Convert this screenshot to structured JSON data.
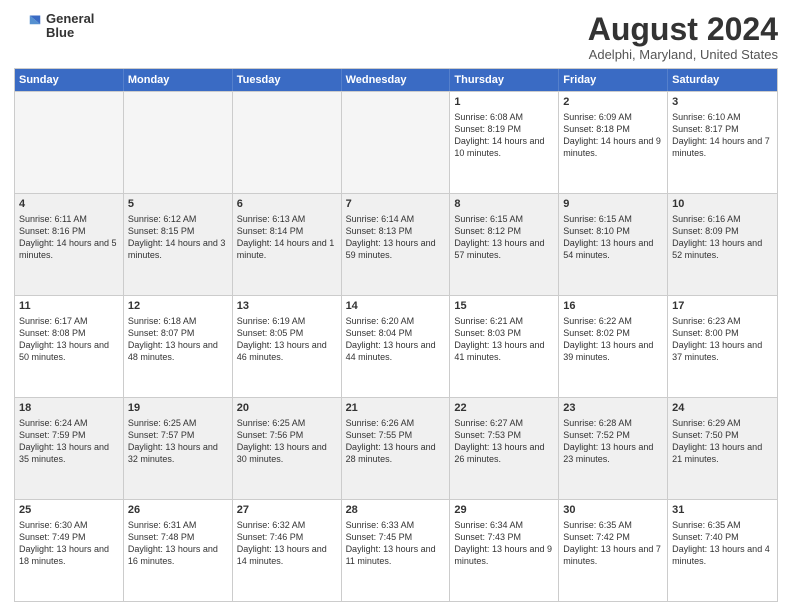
{
  "logo": {
    "line1": "General",
    "line2": "Blue"
  },
  "title": "August 2024",
  "subtitle": "Adelphi, Maryland, United States",
  "header": {
    "days": [
      "Sunday",
      "Monday",
      "Tuesday",
      "Wednesday",
      "Thursday",
      "Friday",
      "Saturday"
    ]
  },
  "rows": [
    {
      "cells": [
        {
          "day": "",
          "info": "",
          "empty": true
        },
        {
          "day": "",
          "info": "",
          "empty": true
        },
        {
          "day": "",
          "info": "",
          "empty": true
        },
        {
          "day": "",
          "info": "",
          "empty": true
        },
        {
          "day": "1",
          "info": "Sunrise: 6:08 AM\nSunset: 8:19 PM\nDaylight: 14 hours and 10 minutes."
        },
        {
          "day": "2",
          "info": "Sunrise: 6:09 AM\nSunset: 8:18 PM\nDaylight: 14 hours and 9 minutes."
        },
        {
          "day": "3",
          "info": "Sunrise: 6:10 AM\nSunset: 8:17 PM\nDaylight: 14 hours and 7 minutes."
        }
      ]
    },
    {
      "cells": [
        {
          "day": "4",
          "info": "Sunrise: 6:11 AM\nSunset: 8:16 PM\nDaylight: 14 hours and 5 minutes.",
          "shaded": true
        },
        {
          "day": "5",
          "info": "Sunrise: 6:12 AM\nSunset: 8:15 PM\nDaylight: 14 hours and 3 minutes.",
          "shaded": true
        },
        {
          "day": "6",
          "info": "Sunrise: 6:13 AM\nSunset: 8:14 PM\nDaylight: 14 hours and 1 minute.",
          "shaded": true
        },
        {
          "day": "7",
          "info": "Sunrise: 6:14 AM\nSunset: 8:13 PM\nDaylight: 13 hours and 59 minutes.",
          "shaded": true
        },
        {
          "day": "8",
          "info": "Sunrise: 6:15 AM\nSunset: 8:12 PM\nDaylight: 13 hours and 57 minutes.",
          "shaded": true
        },
        {
          "day": "9",
          "info": "Sunrise: 6:15 AM\nSunset: 8:10 PM\nDaylight: 13 hours and 54 minutes.",
          "shaded": true
        },
        {
          "day": "10",
          "info": "Sunrise: 6:16 AM\nSunset: 8:09 PM\nDaylight: 13 hours and 52 minutes.",
          "shaded": true
        }
      ]
    },
    {
      "cells": [
        {
          "day": "11",
          "info": "Sunrise: 6:17 AM\nSunset: 8:08 PM\nDaylight: 13 hours and 50 minutes."
        },
        {
          "day": "12",
          "info": "Sunrise: 6:18 AM\nSunset: 8:07 PM\nDaylight: 13 hours and 48 minutes."
        },
        {
          "day": "13",
          "info": "Sunrise: 6:19 AM\nSunset: 8:05 PM\nDaylight: 13 hours and 46 minutes."
        },
        {
          "day": "14",
          "info": "Sunrise: 6:20 AM\nSunset: 8:04 PM\nDaylight: 13 hours and 44 minutes."
        },
        {
          "day": "15",
          "info": "Sunrise: 6:21 AM\nSunset: 8:03 PM\nDaylight: 13 hours and 41 minutes."
        },
        {
          "day": "16",
          "info": "Sunrise: 6:22 AM\nSunset: 8:02 PM\nDaylight: 13 hours and 39 minutes."
        },
        {
          "day": "17",
          "info": "Sunrise: 6:23 AM\nSunset: 8:00 PM\nDaylight: 13 hours and 37 minutes."
        }
      ]
    },
    {
      "cells": [
        {
          "day": "18",
          "info": "Sunrise: 6:24 AM\nSunset: 7:59 PM\nDaylight: 13 hours and 35 minutes.",
          "shaded": true
        },
        {
          "day": "19",
          "info": "Sunrise: 6:25 AM\nSunset: 7:57 PM\nDaylight: 13 hours and 32 minutes.",
          "shaded": true
        },
        {
          "day": "20",
          "info": "Sunrise: 6:25 AM\nSunset: 7:56 PM\nDaylight: 13 hours and 30 minutes.",
          "shaded": true
        },
        {
          "day": "21",
          "info": "Sunrise: 6:26 AM\nSunset: 7:55 PM\nDaylight: 13 hours and 28 minutes.",
          "shaded": true
        },
        {
          "day": "22",
          "info": "Sunrise: 6:27 AM\nSunset: 7:53 PM\nDaylight: 13 hours and 26 minutes.",
          "shaded": true
        },
        {
          "day": "23",
          "info": "Sunrise: 6:28 AM\nSunset: 7:52 PM\nDaylight: 13 hours and 23 minutes.",
          "shaded": true
        },
        {
          "day": "24",
          "info": "Sunrise: 6:29 AM\nSunset: 7:50 PM\nDaylight: 13 hours and 21 minutes.",
          "shaded": true
        }
      ]
    },
    {
      "cells": [
        {
          "day": "25",
          "info": "Sunrise: 6:30 AM\nSunset: 7:49 PM\nDaylight: 13 hours and 18 minutes."
        },
        {
          "day": "26",
          "info": "Sunrise: 6:31 AM\nSunset: 7:48 PM\nDaylight: 13 hours and 16 minutes."
        },
        {
          "day": "27",
          "info": "Sunrise: 6:32 AM\nSunset: 7:46 PM\nDaylight: 13 hours and 14 minutes."
        },
        {
          "day": "28",
          "info": "Sunrise: 6:33 AM\nSunset: 7:45 PM\nDaylight: 13 hours and 11 minutes."
        },
        {
          "day": "29",
          "info": "Sunrise: 6:34 AM\nSunset: 7:43 PM\nDaylight: 13 hours and 9 minutes."
        },
        {
          "day": "30",
          "info": "Sunrise: 6:35 AM\nSunset: 7:42 PM\nDaylight: 13 hours and 7 minutes."
        },
        {
          "day": "31",
          "info": "Sunrise: 6:35 AM\nSunset: 7:40 PM\nDaylight: 13 hours and 4 minutes."
        }
      ]
    }
  ],
  "colors": {
    "header_bg": "#3a6bc4",
    "shaded_bg": "#f0f0f0",
    "empty_bg": "#f5f5f5",
    "border": "#cccccc"
  }
}
